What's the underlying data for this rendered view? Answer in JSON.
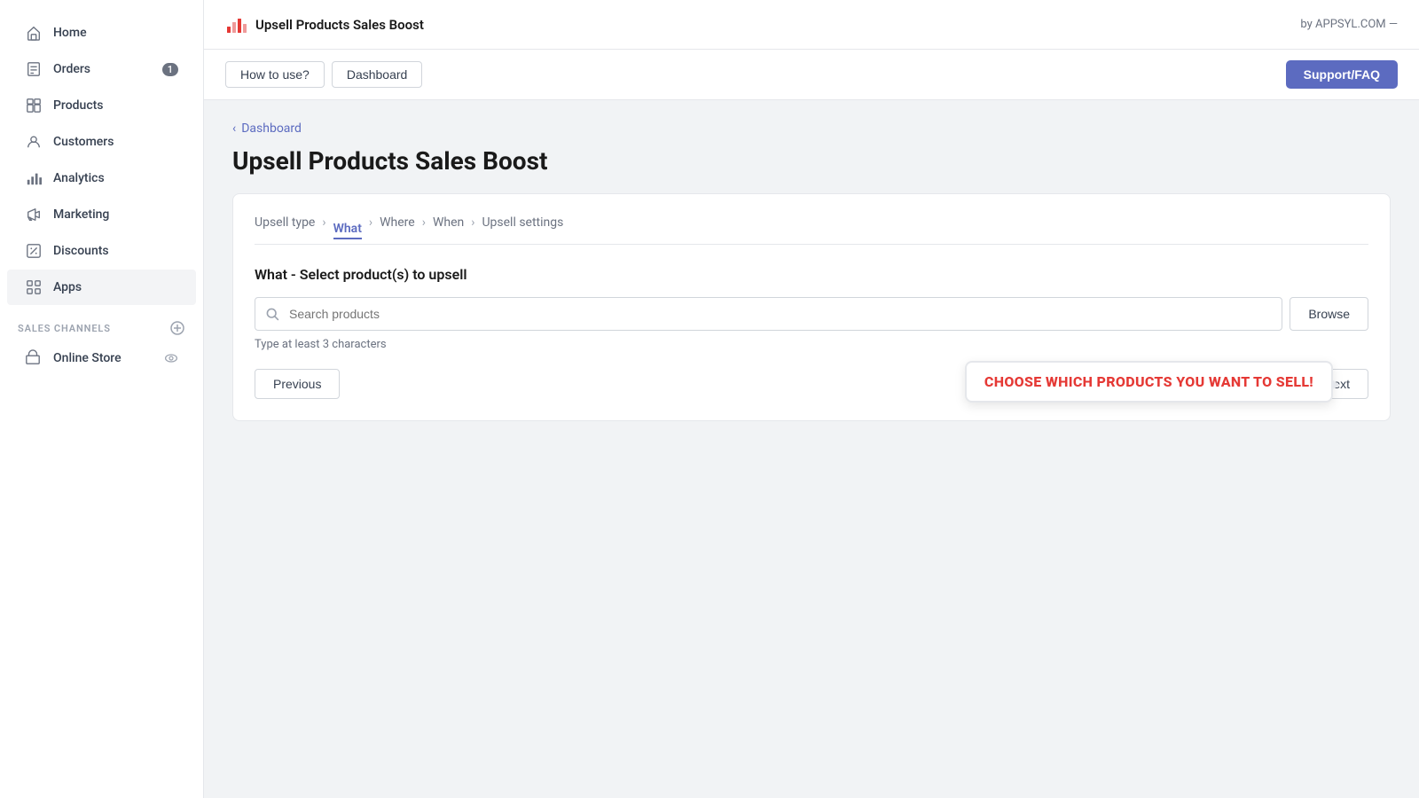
{
  "sidebar": {
    "items": [
      {
        "id": "home",
        "label": "Home",
        "icon": "home"
      },
      {
        "id": "orders",
        "label": "Orders",
        "icon": "orders",
        "badge": "1"
      },
      {
        "id": "products",
        "label": "Products",
        "icon": "products"
      },
      {
        "id": "customers",
        "label": "Customers",
        "icon": "customers"
      },
      {
        "id": "analytics",
        "label": "Analytics",
        "icon": "analytics"
      },
      {
        "id": "marketing",
        "label": "Marketing",
        "icon": "marketing"
      },
      {
        "id": "discounts",
        "label": "Discounts",
        "icon": "discounts"
      },
      {
        "id": "apps",
        "label": "Apps",
        "icon": "apps"
      }
    ],
    "sales_channels_label": "SALES CHANNELS",
    "online_store_label": "Online Store"
  },
  "topbar": {
    "app_title": "Upsell Products Sales Boost",
    "by_label": "by APPSYL.COM —"
  },
  "secondary_nav": {
    "how_to_use_label": "How to use?",
    "dashboard_label": "Dashboard",
    "support_label": "Support/FAQ"
  },
  "breadcrumb": {
    "label": "Dashboard"
  },
  "page": {
    "title": "Upsell Products Sales Boost"
  },
  "stepper": {
    "steps": [
      {
        "id": "upsell-type",
        "label": "Upsell type",
        "active": false
      },
      {
        "id": "what",
        "label": "What",
        "active": true
      },
      {
        "id": "where",
        "label": "Where",
        "active": false
      },
      {
        "id": "when",
        "label": "When",
        "active": false
      },
      {
        "id": "upsell-settings",
        "label": "Upsell settings",
        "active": false
      }
    ]
  },
  "form": {
    "section_title": "What - Select product(s) to upsell",
    "search_placeholder": "Search products",
    "browse_label": "Browse",
    "hint_text": "Type at least 3 characters"
  },
  "footer": {
    "previous_label": "Previous",
    "next_label": "Next",
    "tooltip_text": "CHOOSE WHICH PRODUCTS YOU WANT TO SELL!"
  }
}
